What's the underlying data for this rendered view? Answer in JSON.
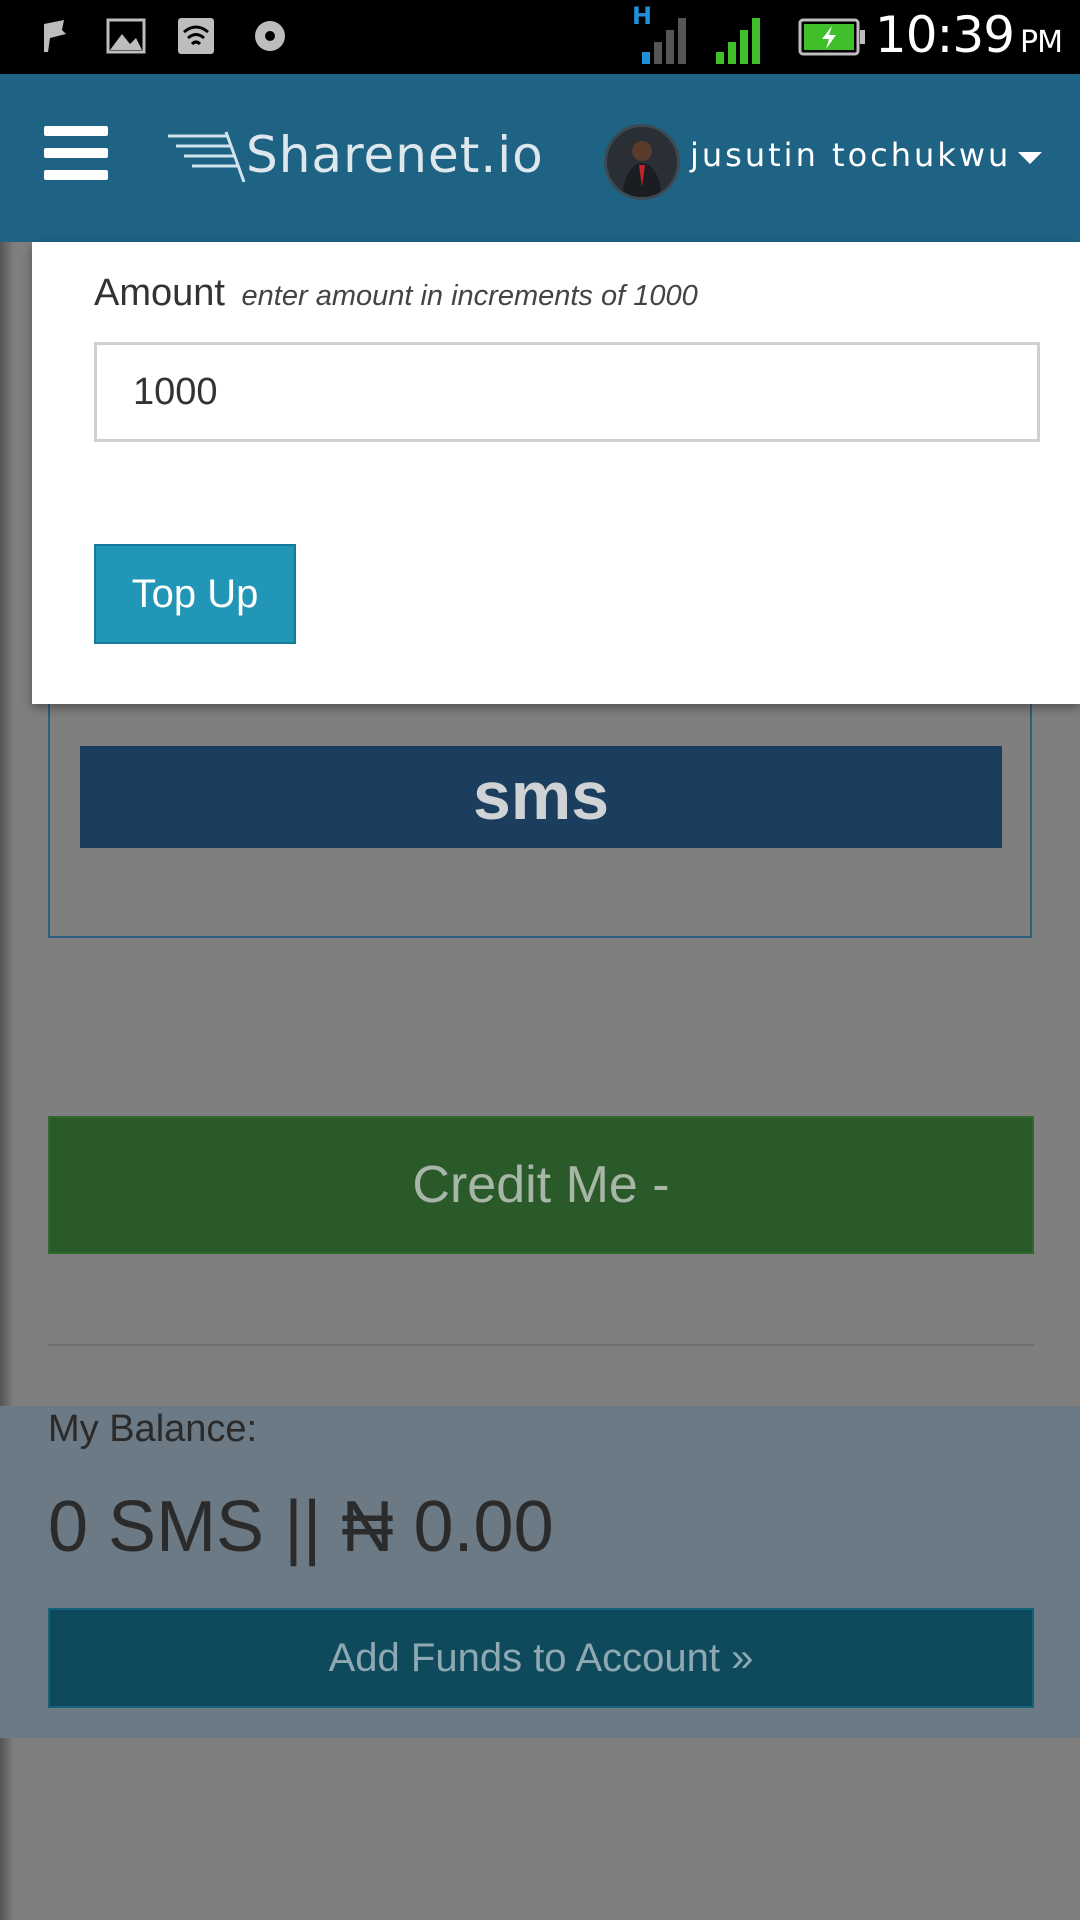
{
  "status_bar": {
    "time": "10:39",
    "ampm": "PM",
    "network_label": "H",
    "icons": [
      "notification-icon",
      "image-icon",
      "wifi-icon",
      "radio-icon",
      "signal-h-icon",
      "signal-icon",
      "battery-charging-icon"
    ]
  },
  "header": {
    "logo_text": "Sharenet.io",
    "username": "jusutin tochukwu"
  },
  "modal": {
    "amount_label": "Amount",
    "amount_hint": "enter amount in increments of 1000",
    "amount_value": "1000",
    "topup_label": "Top Up"
  },
  "page": {
    "sms_label": "sms",
    "credit_label": "Credit Me -",
    "balance_label": "My Balance:",
    "balance_value": "0 SMS || ₦ 0.00",
    "add_funds_label": "Add Funds to Account »"
  },
  "colors": {
    "header_bg": "#1f6384",
    "topup_btn": "#2196b7",
    "credit_btn": "#2b5a2a",
    "add_funds_btn": "#0f4a5c",
    "sms_bar": "#1c3e5e"
  }
}
